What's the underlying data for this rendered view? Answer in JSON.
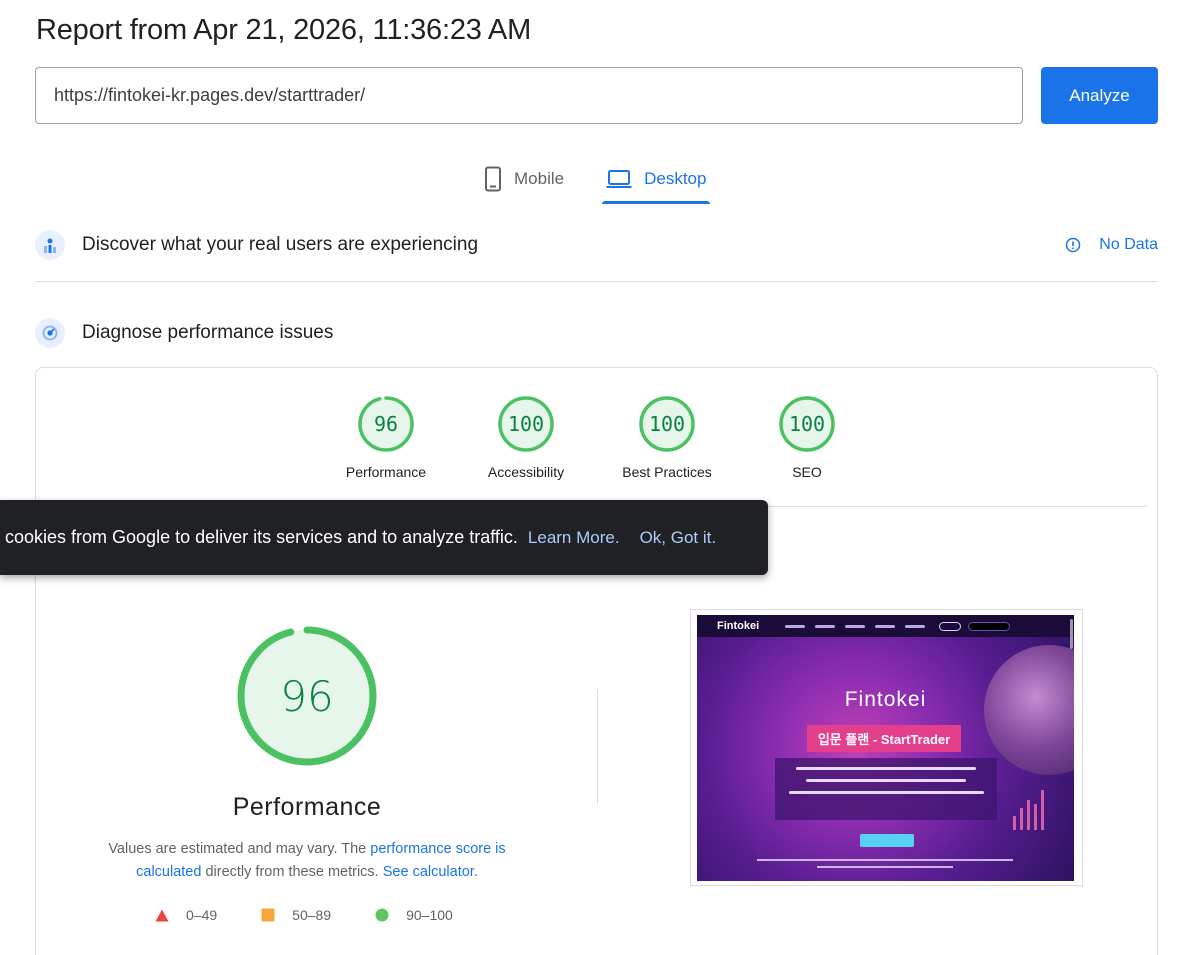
{
  "report": {
    "title": "Report from Apr 21, 2026, 11:36:23 AM"
  },
  "search": {
    "url": "https://fintokei-kr.pages.dev/starttrader/",
    "analyze_label": "Analyze"
  },
  "device_tabs": [
    {
      "label": "Mobile",
      "icon": "smartphone-icon",
      "active": false
    },
    {
      "label": "Desktop",
      "icon": "laptop-icon",
      "active": true
    }
  ],
  "field_data": {
    "title": "Discover what your real users are experiencing",
    "status": "No Data",
    "icon": "bar-chart-icon"
  },
  "lab_data": {
    "title": "Diagnose performance issues",
    "icon": "gauge-icon"
  },
  "scores": [
    {
      "label": "Performance",
      "value": 96
    },
    {
      "label": "Accessibility",
      "value": 100
    },
    {
      "label": "Best Practices",
      "value": 100
    },
    {
      "label": "SEO",
      "value": 100
    }
  ],
  "cookie_banner": {
    "text": "cookies from Google to deliver its services and to analyze traffic.",
    "learn_more": "Learn More.",
    "ok": "Ok, Got it."
  },
  "main_score": {
    "value": 96,
    "label": "Performance",
    "desc_prefix": "Values are estimated and may vary. The ",
    "desc_link1": "performance score is calculated",
    "desc_middle": " directly from these metrics. ",
    "desc_link2": "See calculator",
    "desc_suffix": "."
  },
  "legend": [
    {
      "range": "0–49",
      "shape": "triangle",
      "color": "#e8453c"
    },
    {
      "range": "50–89",
      "shape": "square",
      "color": "#f4a73c"
    },
    {
      "range": "90–100",
      "shape": "circle",
      "color": "#5ec45e"
    }
  ],
  "screenshot": {
    "brand": "Fintokei",
    "banner": "입문 플랜 - StartTrader"
  },
  "colors": {
    "accent": "#1a73e8",
    "pass": "#0cce6b",
    "pass_text": "#0b8043"
  }
}
